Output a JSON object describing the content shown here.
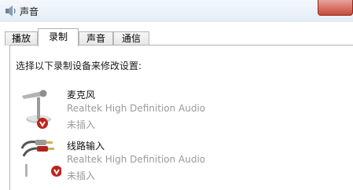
{
  "window": {
    "title": "声音"
  },
  "tabs": [
    {
      "label": "播放",
      "active": false
    },
    {
      "label": "录制",
      "active": true
    },
    {
      "label": "声音",
      "active": false
    },
    {
      "label": "通信",
      "active": false
    }
  ],
  "recording": {
    "prompt": "选择以下录制设备来修改设置:",
    "devices": [
      {
        "name": "麦克风",
        "driver": "Realtek High Definition Audio",
        "status": "未插入",
        "icon": "microphone-icon"
      },
      {
        "name": "线路输入",
        "driver": "Realtek High Definition Audio",
        "status": "未插入",
        "icon": "line-in-cable-icon"
      }
    ]
  },
  "colors": {
    "status_badge": "#c0221b",
    "close_button": "#c94a39"
  }
}
